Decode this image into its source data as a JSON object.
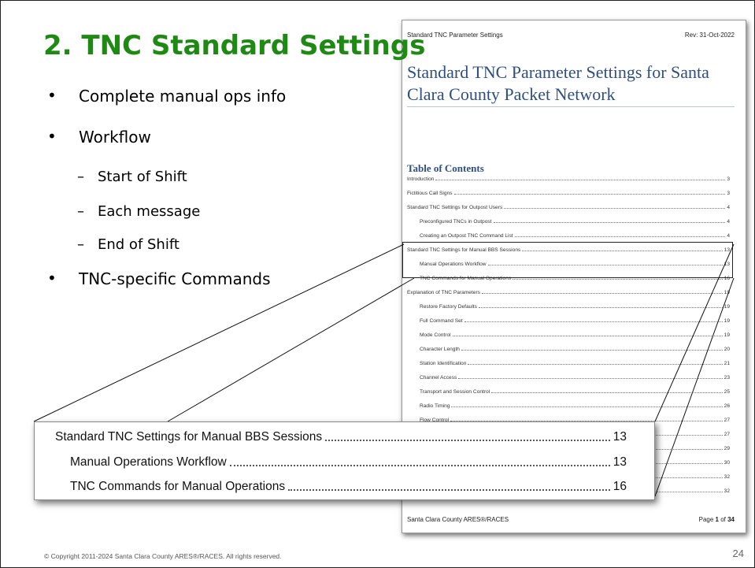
{
  "slide": {
    "title": "2.  TNC Standard Settings",
    "bullets": [
      {
        "text": "Complete manual ops info",
        "level": 1
      },
      {
        "text": "Workflow",
        "level": 1
      },
      {
        "text": "Start of Shift",
        "level": 2
      },
      {
        "text": "Each message",
        "level": 2
      },
      {
        "text": "End of Shift",
        "level": 2
      },
      {
        "text": "TNC-specific Commands",
        "level": 1
      }
    ],
    "bullet_glyph": "•",
    "sub_glyph": "–",
    "copyright": "© Copyright 2011-2024 Santa Clara County ARES®/RACES. All rights reserved.",
    "page_number": "24",
    "title_color": "#1e8a14"
  },
  "document": {
    "header_left": "Standard TNC Parameter Settings",
    "header_right": "Rev: 31-Oct-2022",
    "title": "Standard TNC Parameter Settings for Santa Clara County Packet Network",
    "toc_heading": "Table of Contents",
    "toc": [
      {
        "label": "Introduction",
        "page": "3",
        "indent": false
      },
      {
        "label": "Fictitious Call Signs",
        "page": "3",
        "indent": false
      },
      {
        "label": "Standard TNC Settings for Outpost Users",
        "page": "4",
        "indent": false
      },
      {
        "label": "Preconfigured TNCs in Outpost",
        "page": "4",
        "indent": true
      },
      {
        "label": "Creating an Outpost TNC Command List",
        "page": "4",
        "indent": true
      },
      {
        "label": "Standard TNC Settings for Manual BBS Sessions",
        "page": "13",
        "indent": false
      },
      {
        "label": "Manual Operations Workflow",
        "page": "13",
        "indent": true
      },
      {
        "label": "TNC Commands for Manual Operations",
        "page": "16",
        "indent": true
      },
      {
        "label": "Explanation of TNC Parameters",
        "page": "19",
        "indent": false
      },
      {
        "label": "Restore Factory Defaults",
        "page": "19",
        "indent": true
      },
      {
        "label": "Full Command Set",
        "page": "19",
        "indent": true
      },
      {
        "label": "Mode Control",
        "page": "19",
        "indent": true
      },
      {
        "label": "Character Length",
        "page": "20",
        "indent": true
      },
      {
        "label": "Station Identification",
        "page": "21",
        "indent": true
      },
      {
        "label": "Channel Access",
        "page": "23",
        "indent": true
      },
      {
        "label": "Transport and Session Control",
        "page": "25",
        "indent": true
      },
      {
        "label": "Radio Timing",
        "page": "26",
        "indent": true
      },
      {
        "label": "Flow Control",
        "page": "27",
        "indent": true
      },
      {
        "label": "",
        "page": "27",
        "indent": true
      },
      {
        "label": "",
        "page": "29",
        "indent": true
      },
      {
        "label": "",
        "page": "30",
        "indent": true
      },
      {
        "label": "",
        "page": "32",
        "indent": true
      },
      {
        "label": "",
        "page": "32",
        "indent": true
      }
    ],
    "footer_left": "Santa Clara County ARES®/RACES",
    "footer_page_prefix": "Page ",
    "footer_page_current": "1",
    "footer_page_mid": " of ",
    "footer_page_total": "34",
    "title_color": "#2e4f7f"
  },
  "zoom": {
    "rows": [
      {
        "label": "Standard TNC Settings for Manual BBS Sessions",
        "page": "13",
        "indent": false
      },
      {
        "label": "Manual Operations Workflow",
        "page": "13",
        "indent": true
      },
      {
        "label": "TNC Commands for Manual Operations",
        "page": "16",
        "indent": true
      }
    ]
  }
}
